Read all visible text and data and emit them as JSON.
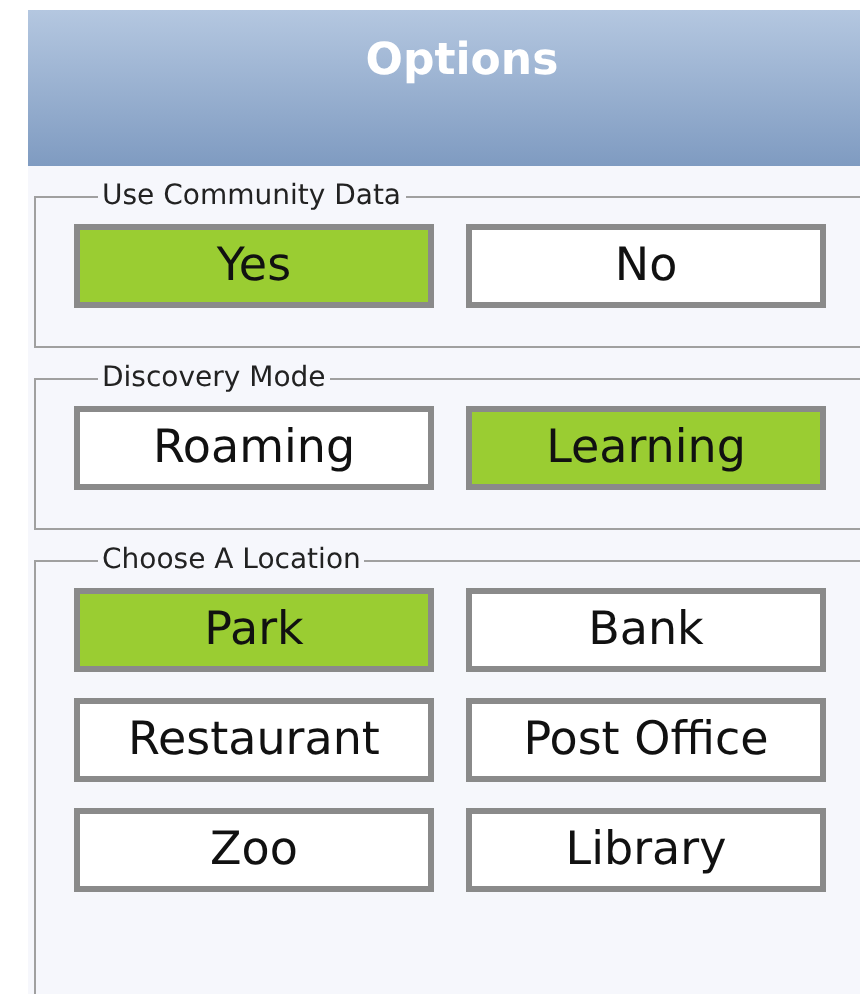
{
  "header": {
    "title": "Options"
  },
  "groups": [
    {
      "legend": "Use Community Data",
      "options": [
        {
          "label": "Yes",
          "selected": true
        },
        {
          "label": "No",
          "selected": false
        }
      ]
    },
    {
      "legend": "Discovery Mode",
      "options": [
        {
          "label": "Roaming",
          "selected": false
        },
        {
          "label": "Learning",
          "selected": true
        }
      ]
    },
    {
      "legend": "Choose A Location",
      "options": [
        {
          "label": "Park",
          "selected": true
        },
        {
          "label": "Bank",
          "selected": false
        },
        {
          "label": "Restaurant",
          "selected": false
        },
        {
          "label": "Post Office",
          "selected": false
        },
        {
          "label": "Zoo",
          "selected": false
        },
        {
          "label": "Library",
          "selected": false
        }
      ]
    }
  ]
}
